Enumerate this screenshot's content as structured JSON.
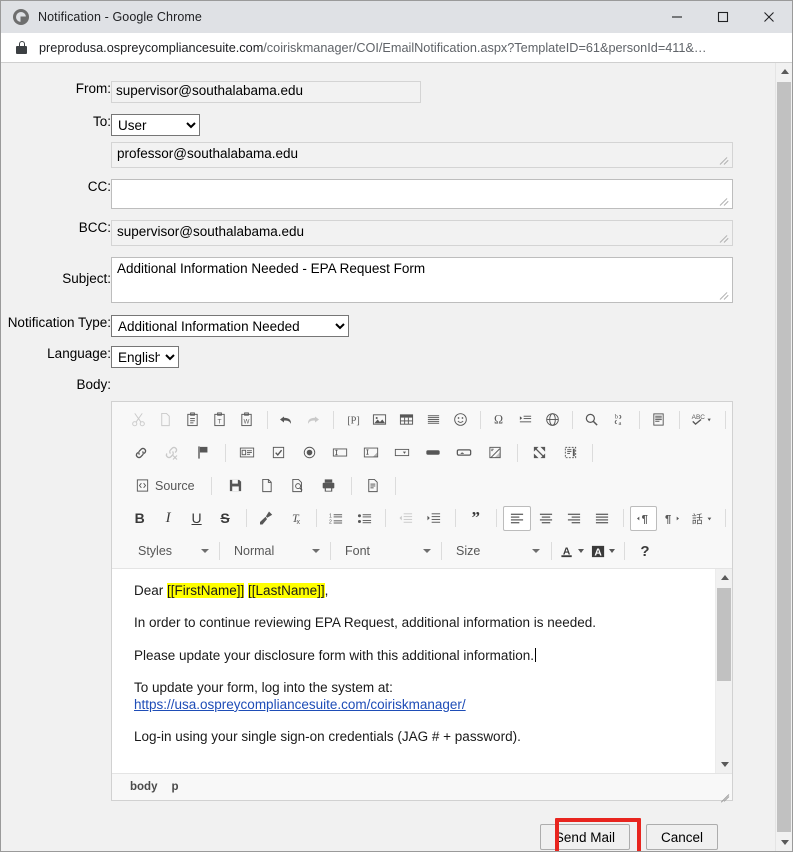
{
  "window": {
    "title": "Notification - Google Chrome",
    "favicon": "globe-icon",
    "minimize": "minimize-icon",
    "maximize": "maximize-icon",
    "close": "close-icon"
  },
  "address_bar": {
    "lock": "lock-icon",
    "url_host": "preprodusa.ospreycompliancesuite.com",
    "url_path": "/coiriskmanager/COI/EmailNotification.aspx?TemplateID=61&personId=411&…"
  },
  "form": {
    "labels": {
      "from": "From:",
      "to": "To:",
      "cc": "CC:",
      "bcc": "BCC:",
      "subject": "Subject:",
      "notification_type": "Notification Type:",
      "language": "Language:",
      "body": "Body:"
    },
    "from_value": "supervisor@southalabama.edu",
    "to_type": "User",
    "to_type_options": [
      "User"
    ],
    "to_value": "professor@southalabama.edu",
    "cc_value": "",
    "bcc_value": "supervisor@southalabama.edu",
    "subject_value": "Additional Information Needed - EPA Request Form",
    "notification_type_value": "Additional Information Needed",
    "notification_type_options": [
      "Additional Information Needed"
    ],
    "language_value": "English",
    "language_options": [
      "English"
    ]
  },
  "editor": {
    "toolbar_row1": [
      {
        "name": "cut-icon",
        "disabled": true
      },
      {
        "name": "copy-icon",
        "disabled": true
      },
      {
        "name": "paste-icon",
        "disabled": false
      },
      {
        "name": "paste-as-plain-text-icon",
        "disabled": false
      },
      {
        "name": "paste-from-word-icon",
        "disabled": false
      },
      {
        "name": "undo-icon",
        "disabled": false
      },
      {
        "name": "redo-icon",
        "disabled": true
      },
      {
        "name": "placeholder-icon",
        "disabled": false
      },
      {
        "name": "image-icon",
        "disabled": false
      },
      {
        "name": "table-icon",
        "disabled": false
      },
      {
        "name": "horizontal-rule-icon",
        "disabled": false
      },
      {
        "name": "smiley-icon",
        "disabled": false
      },
      {
        "name": "special-character-icon",
        "disabled": false
      },
      {
        "name": "page-break-icon",
        "disabled": false
      },
      {
        "name": "iframe-icon",
        "disabled": false
      },
      {
        "name": "find-icon",
        "disabled": false
      },
      {
        "name": "replace-icon",
        "disabled": false
      },
      {
        "name": "templates-icon",
        "disabled": false
      },
      {
        "name": "spell-check-icon",
        "disabled": false
      }
    ],
    "toolbar_row2": [
      {
        "name": "link-icon",
        "disabled": false
      },
      {
        "name": "unlink-icon",
        "disabled": true
      },
      {
        "name": "anchor-icon",
        "disabled": false
      },
      {
        "name": "form-icon",
        "disabled": false
      },
      {
        "name": "checkbox-icon",
        "disabled": false
      },
      {
        "name": "radio-button-icon",
        "disabled": false
      },
      {
        "name": "text-field-icon",
        "disabled": false
      },
      {
        "name": "textarea-icon",
        "disabled": false
      },
      {
        "name": "select-field-icon",
        "disabled": false
      },
      {
        "name": "button-icon",
        "disabled": false
      },
      {
        "name": "image-button-icon",
        "disabled": false
      },
      {
        "name": "hidden-field-icon",
        "disabled": false
      },
      {
        "name": "maximize-icon",
        "disabled": false
      },
      {
        "name": "show-blocks-icon",
        "disabled": false
      }
    ],
    "toolbar_row3": [
      {
        "name": "source-icon",
        "label": "Source",
        "disabled": false
      },
      {
        "name": "save-icon",
        "disabled": false
      },
      {
        "name": "new-page-icon",
        "disabled": false
      },
      {
        "name": "preview-icon",
        "disabled": false
      },
      {
        "name": "print-icon",
        "disabled": false
      },
      {
        "name": "document-properties-icon",
        "disabled": false
      }
    ],
    "toolbar_row4": [
      {
        "name": "bold-icon",
        "glyph": "B",
        "disabled": false
      },
      {
        "name": "italic-icon",
        "glyph": "I",
        "disabled": false
      },
      {
        "name": "underline-icon",
        "glyph": "U",
        "disabled": false
      },
      {
        "name": "strikethrough-icon",
        "glyph": "S",
        "disabled": false
      },
      {
        "name": "remove-format-icon",
        "disabled": false
      },
      {
        "name": "subscript-superscript-icon",
        "disabled": false
      },
      {
        "name": "numbered-list-icon",
        "disabled": false
      },
      {
        "name": "bulleted-list-icon",
        "disabled": false
      },
      {
        "name": "decrease-indent-icon",
        "disabled": true
      },
      {
        "name": "increase-indent-icon",
        "disabled": false
      },
      {
        "name": "blockquote-icon",
        "disabled": false
      },
      {
        "name": "align-left-icon",
        "disabled": false,
        "active": true
      },
      {
        "name": "align-center-icon",
        "disabled": false
      },
      {
        "name": "align-right-icon",
        "disabled": false
      },
      {
        "name": "justify-icon",
        "disabled": false
      },
      {
        "name": "text-direction-ltr-icon",
        "disabled": false,
        "active": true
      },
      {
        "name": "text-direction-rtl-icon",
        "disabled": false
      },
      {
        "name": "language-icon",
        "disabled": false
      }
    ],
    "combos": [
      {
        "name": "styles-combo",
        "label": "Styles"
      },
      {
        "name": "paragraph-format-combo",
        "label": "Normal"
      },
      {
        "name": "font-combo",
        "label": "Font"
      },
      {
        "name": "font-size-combo",
        "label": "Size"
      }
    ],
    "color_buttons": [
      {
        "name": "text-color-icon",
        "glyph": "A"
      },
      {
        "name": "background-color-icon",
        "glyph": "A"
      }
    ],
    "about_button": {
      "name": "about-icon",
      "glyph": "?"
    },
    "body_content": {
      "salutation_prefix": "Dear ",
      "placeholder_first_name": "[[FirstName]]",
      "placeholder_last_name": "[[LastName]]",
      "salutation_suffix": ",",
      "paragraph_2": "In order to continue reviewing EPA Request, additional information is needed.",
      "paragraph_3": "Please update your disclosure form with this additional information.",
      "paragraph_4_line1": "To update your form, log into the system at:",
      "paragraph_4_link": "https://usa.ospreycompliancesuite.com/coiriskmanager/",
      "paragraph_5": "Log-in using your single sign-on credentials (JAG # + password)."
    },
    "element_path": [
      "body",
      "p"
    ]
  },
  "footer": {
    "send_mail_label": "Send Mail",
    "cancel_label": "Cancel",
    "highlight_color": "#e8251f"
  }
}
